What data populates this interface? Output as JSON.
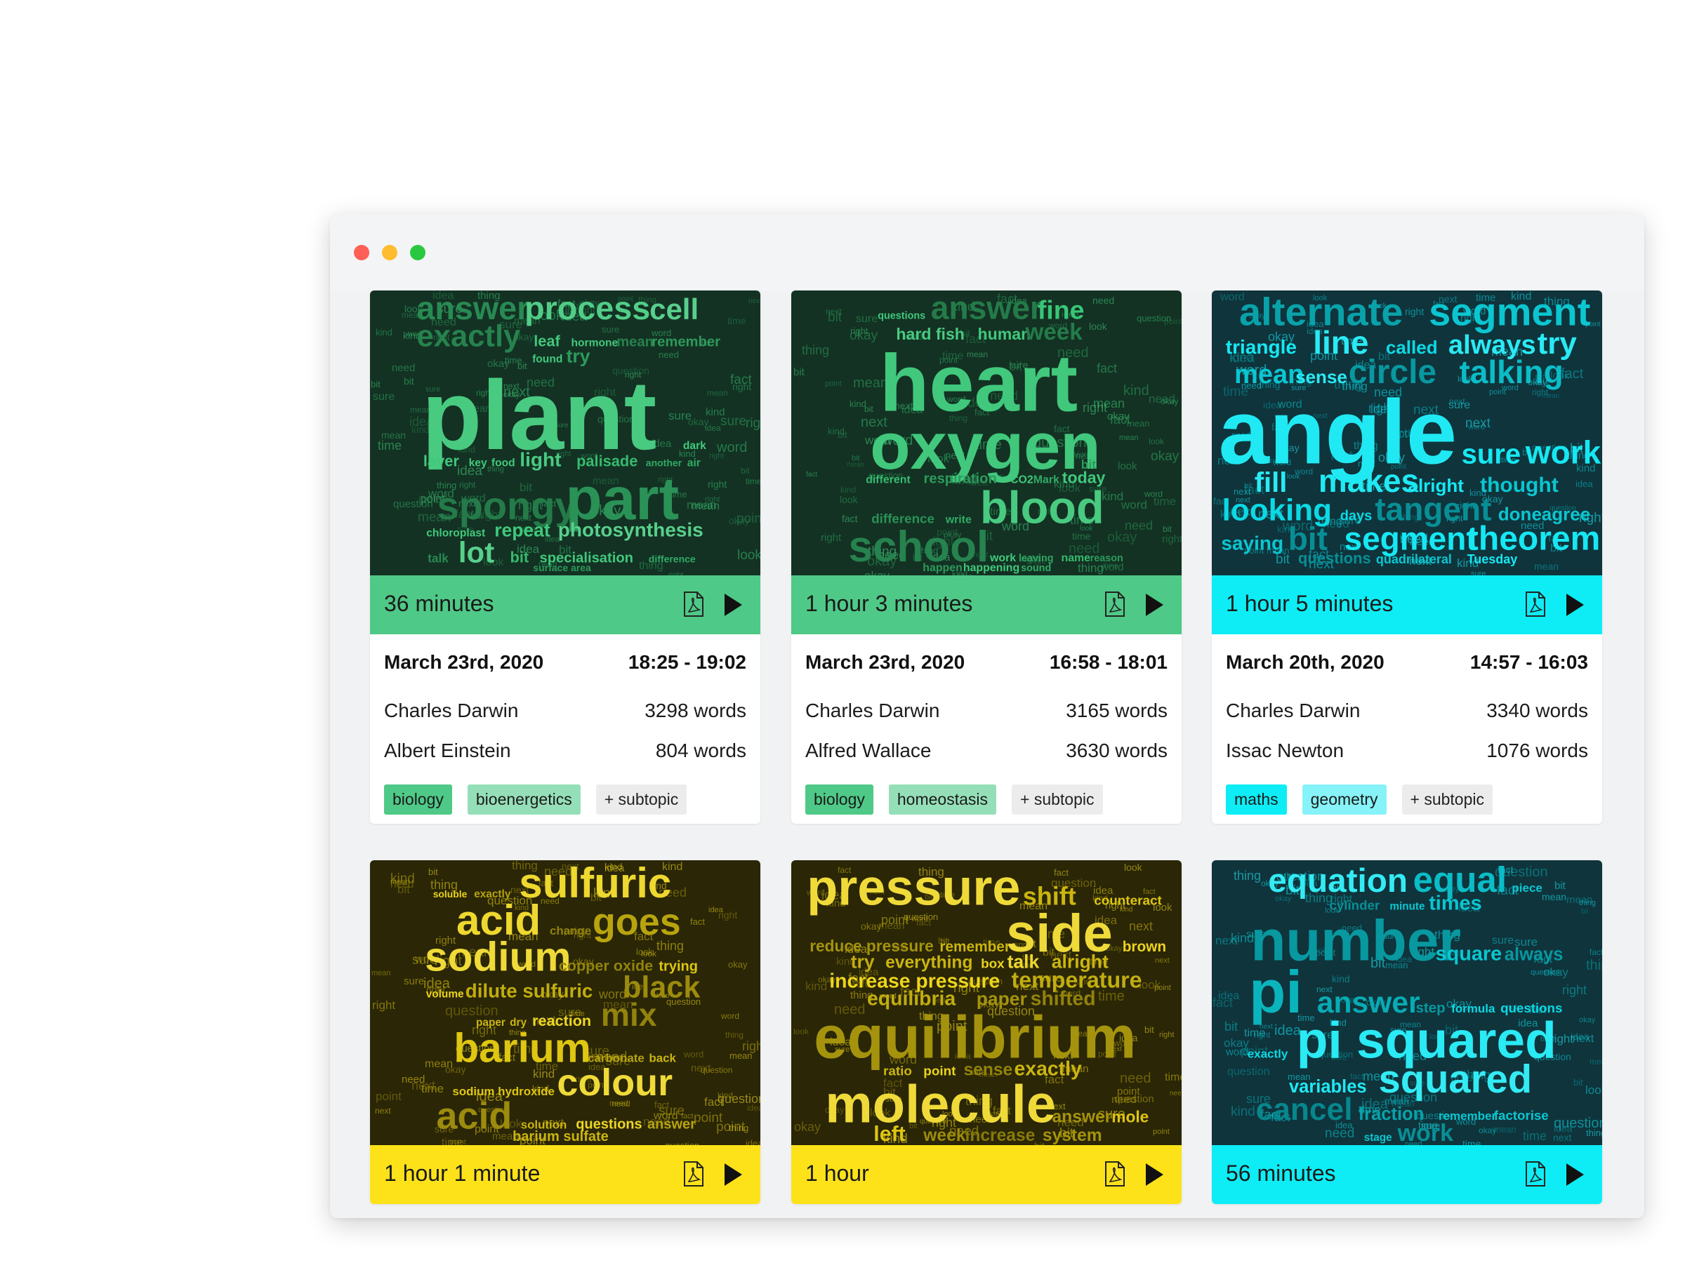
{
  "colors": {
    "green": "#4fc987",
    "green_light": "#95dfb8",
    "green_cloud_bg": "#133223",
    "cyan": "#0eedf5",
    "cyan_light": "#86f3f8",
    "cyan_cloud_bg": "#0f343c",
    "yellow": "#fde21a",
    "yellow_cloud_bg": "#2a2606"
  },
  "cards": [
    {
      "duration": "36 minutes",
      "theme": "green",
      "date": "March 23rd, 2020",
      "time": "18:25 - 19:02",
      "speakers": [
        {
          "name": "Charles Darwin",
          "words": "3298 words"
        },
        {
          "name": "Albert Einstein",
          "words": "804 words"
        }
      ],
      "tags": [
        "biology",
        "bioenergetics"
      ],
      "add_tag": "+ subtopic",
      "cloud": [
        [
          "answer",
          60,
          0.4
        ],
        [
          "process",
          60,
          0.9
        ],
        [
          "cell",
          54,
          0.95
        ],
        [
          "exactly",
          56,
          0.35
        ],
        [
          "leaf",
          28,
          0.8
        ],
        [
          "hormone",
          20,
          0.8
        ],
        [
          "mean",
          26,
          0.35
        ],
        [
          "remember",
          26,
          0.5
        ],
        [
          "found",
          20,
          0.8
        ],
        [
          "try",
          34,
          0.5
        ],
        [
          "plant",
          180,
          0.85
        ],
        [
          "dark",
          20,
          0.8
        ],
        [
          "layer",
          28,
          0.8
        ],
        [
          "key",
          20,
          0.8
        ],
        [
          "food",
          20,
          0.8
        ],
        [
          "light",
          36,
          0.85
        ],
        [
          "palisade",
          28,
          0.7
        ],
        [
          "another",
          18,
          0.6
        ],
        [
          "air",
          20,
          0.6
        ],
        [
          "spongy",
          72,
          0.3
        ],
        [
          "part",
          110,
          0.45
        ],
        [
          "chloroplast",
          20,
          0.8
        ],
        [
          "repeat",
          34,
          0.8
        ],
        [
          "photosynthesis",
          36,
          0.95
        ],
        [
          "talk",
          22,
          0.4
        ],
        [
          "lot",
          54,
          0.95
        ],
        [
          "bit",
          28,
          0.7
        ],
        [
          "specialisation",
          26,
          0.8
        ],
        [
          "difference",
          18,
          0.6
        ],
        [
          "surface area",
          18,
          0.5
        ]
      ]
    },
    {
      "duration": "1 hour 3 minutes",
      "theme": "green",
      "date": "March 23rd, 2020",
      "time": "16:58 - 18:01",
      "speakers": [
        {
          "name": "Charles Darwin",
          "words": "3165 words"
        },
        {
          "name": "Alfred Wallace",
          "words": "3630 words"
        }
      ],
      "tags": [
        "biology",
        "homeostasis"
      ],
      "add_tag": "+ subtopic",
      "cloud": [
        [
          "questions",
          20,
          0.8
        ],
        [
          "answer",
          64,
          0.3
        ],
        [
          "fine",
          52,
          0.75
        ],
        [
          "hard fish",
          32,
          0.85
        ],
        [
          "human",
          32,
          0.8
        ],
        [
          "week",
          46,
          0.3
        ],
        [
          "heart",
          160,
          0.8
        ],
        [
          "oxygen",
          130,
          0.8
        ],
        [
          "bit",
          24,
          0.5
        ],
        [
          "different",
          22,
          0.7
        ],
        [
          "respiration",
          28,
          0.5
        ],
        [
          "CO2",
          22,
          0.8
        ],
        [
          "Mark",
          22,
          0.6
        ],
        [
          "today",
          32,
          0.8
        ],
        [
          "difference",
          26,
          0.45
        ],
        [
          "write",
          22,
          0.6
        ],
        [
          "blood",
          90,
          0.85
        ],
        [
          "school",
          86,
          0.35
        ],
        [
          "work",
          22,
          0.8
        ],
        [
          "leaving",
          20,
          0.55
        ],
        [
          "name",
          22,
          0.7
        ],
        [
          "reason",
          20,
          0.5
        ],
        [
          "happen",
          22,
          0.5
        ],
        [
          "happening",
          22,
          0.8
        ],
        [
          "sound",
          20,
          0.6
        ]
      ]
    },
    {
      "duration": "1 hour 5 minutes",
      "theme": "cyan",
      "date": "March 20th, 2020",
      "time": "14:57 - 16:03",
      "speakers": [
        {
          "name": "Charles Darwin",
          "words": "3340 words"
        },
        {
          "name": "Issac Newton",
          "words": "1076 words"
        }
      ],
      "tags": [
        "maths",
        "geometry"
      ],
      "add_tag": "+ subtopic",
      "cloud": [
        [
          "alternate",
          56,
          0.4
        ],
        [
          "segment",
          56,
          0.6
        ],
        [
          "triangle",
          28,
          0.8
        ],
        [
          "line",
          46,
          0.9
        ],
        [
          "called",
          26,
          0.7
        ],
        [
          "always",
          38,
          0.9
        ],
        [
          "try",
          44,
          0.9
        ],
        [
          "mean",
          38,
          0.6
        ],
        [
          "sense",
          26,
          0.9
        ],
        [
          "circle",
          48,
          0.35
        ],
        [
          "talking",
          46,
          0.55
        ],
        [
          "angle",
          130,
          0.85
        ],
        [
          "sure",
          40,
          0.8
        ],
        [
          "work",
          46,
          0.8
        ],
        [
          "fill",
          40,
          0.9
        ],
        [
          "makes",
          46,
          0.85
        ],
        [
          "alright",
          26,
          0.8
        ],
        [
          "thought",
          30,
          0.6
        ],
        [
          "looking",
          44,
          0.7
        ],
        [
          "days",
          20,
          0.7
        ],
        [
          "tangent",
          46,
          0.3
        ],
        [
          "done",
          26,
          0.6
        ],
        [
          "agree",
          26,
          0.6
        ],
        [
          "saying",
          28,
          0.6
        ],
        [
          "bit",
          46,
          0.3
        ],
        [
          "segment",
          46,
          0.8
        ],
        [
          "theorem",
          48,
          0.8
        ],
        [
          "questions",
          22,
          0.3
        ],
        [
          "quadrilateral",
          18,
          0.6
        ],
        [
          "Tuesday",
          18,
          0.8
        ]
      ]
    },
    {
      "duration": "1 hour 1 minute",
      "theme": "yellow",
      "cloud": [
        [
          "soluble",
          18,
          0.8
        ],
        [
          "exactly",
          20,
          0.5
        ],
        [
          "sulfuric",
          78,
          0.9
        ],
        [
          "acid",
          78,
          0.9
        ],
        [
          "change",
          22,
          0.3
        ],
        [
          "goes",
          70,
          0.5
        ],
        [
          "sodium",
          76,
          0.95
        ],
        [
          "copper oxide",
          28,
          0.3
        ],
        [
          "trying",
          26,
          0.7
        ],
        [
          "volume",
          20,
          0.8
        ],
        [
          "dilute sulfuric",
          36,
          0.55
        ],
        [
          "black",
          56,
          0.35
        ],
        [
          "paper",
          20,
          0.6
        ],
        [
          "dry",
          20,
          0.6
        ],
        [
          "reaction",
          28,
          0.85
        ],
        [
          "mix",
          60,
          0.3
        ],
        [
          "barium",
          76,
          0.7
        ],
        [
          "carbonate",
          22,
          0.5
        ],
        [
          "back",
          22,
          0.6
        ],
        [
          "sodium hydroxide",
          22,
          0.7
        ],
        [
          "colour",
          70,
          0.95
        ],
        [
          "acid",
          70,
          0.35
        ],
        [
          "solution",
          22,
          0.6
        ],
        [
          "questions",
          26,
          0.85
        ],
        [
          "answer",
          26,
          0.5
        ],
        [
          "barium sulfate",
          26,
          0.6
        ]
      ]
    },
    {
      "duration": "1 hour",
      "theme": "yellow",
      "cloud": [
        [
          "pressure",
          76,
          0.95
        ],
        [
          "shift",
          38,
          0.6
        ],
        [
          "counteract",
          20,
          0.7
        ],
        [
          "reduce pressure",
          24,
          0.4
        ],
        [
          "remember",
          22,
          0.6
        ],
        [
          "side",
          80,
          0.95
        ],
        [
          "brown",
          22,
          0.8
        ],
        [
          "try",
          28,
          0.55
        ],
        [
          "everything",
          26,
          0.6
        ],
        [
          "box",
          20,
          0.8
        ],
        [
          "talk",
          28,
          0.9
        ],
        [
          "alright",
          28,
          0.6
        ],
        [
          "increase pressure",
          30,
          0.8
        ],
        [
          "temperature",
          34,
          0.55
        ],
        [
          "equilibria",
          30,
          0.55
        ],
        [
          "paper",
          28,
          0.4
        ],
        [
          "shifted",
          30,
          0.3
        ],
        [
          "equilibrium",
          90,
          0.4
        ],
        [
          "ratio",
          20,
          0.6
        ],
        [
          "point",
          20,
          0.8
        ],
        [
          "sense",
          26,
          0.3
        ],
        [
          "exactly",
          30,
          0.6
        ],
        [
          "molecule",
          80,
          0.95
        ],
        [
          "answer",
          26,
          0.4
        ],
        [
          "mole",
          24,
          0.7
        ],
        [
          "left",
          32,
          0.7
        ],
        [
          "week",
          26,
          0.35
        ],
        [
          "increase",
          26,
          0.25
        ],
        [
          "system",
          26,
          0.4
        ]
      ]
    },
    {
      "duration": "56 minutes",
      "theme": "cyan",
      "cloud": [
        [
          "equation",
          56,
          0.95
        ],
        [
          "equal",
          60,
          0.55
        ],
        [
          "piece",
          20,
          0.6
        ],
        [
          "cylinder",
          22,
          0.3
        ],
        [
          "minute",
          18,
          0.6
        ],
        [
          "times",
          34,
          0.6
        ],
        [
          "number",
          96,
          0.35
        ],
        [
          "square",
          34,
          0.6
        ],
        [
          "always",
          30,
          0.35
        ],
        [
          "pi",
          100,
          0.5
        ],
        [
          "answer",
          50,
          0.45
        ],
        [
          "step",
          24,
          0.35
        ],
        [
          "formula",
          20,
          0.7
        ],
        [
          "questions",
          22,
          0.7
        ],
        [
          "exactly",
          20,
          0.7
        ],
        [
          "pi squared",
          86,
          0.9
        ],
        [
          "variables",
          30,
          0.85
        ],
        [
          "squared",
          66,
          0.95
        ],
        [
          "cancel",
          52,
          0.25
        ],
        [
          "fraction",
          30,
          0.4
        ],
        [
          "remember",
          20,
          0.6
        ],
        [
          "factorise",
          22,
          0.6
        ],
        [
          "stage",
          18,
          0.6
        ],
        [
          "work",
          40,
          0.3
        ]
      ]
    }
  ]
}
